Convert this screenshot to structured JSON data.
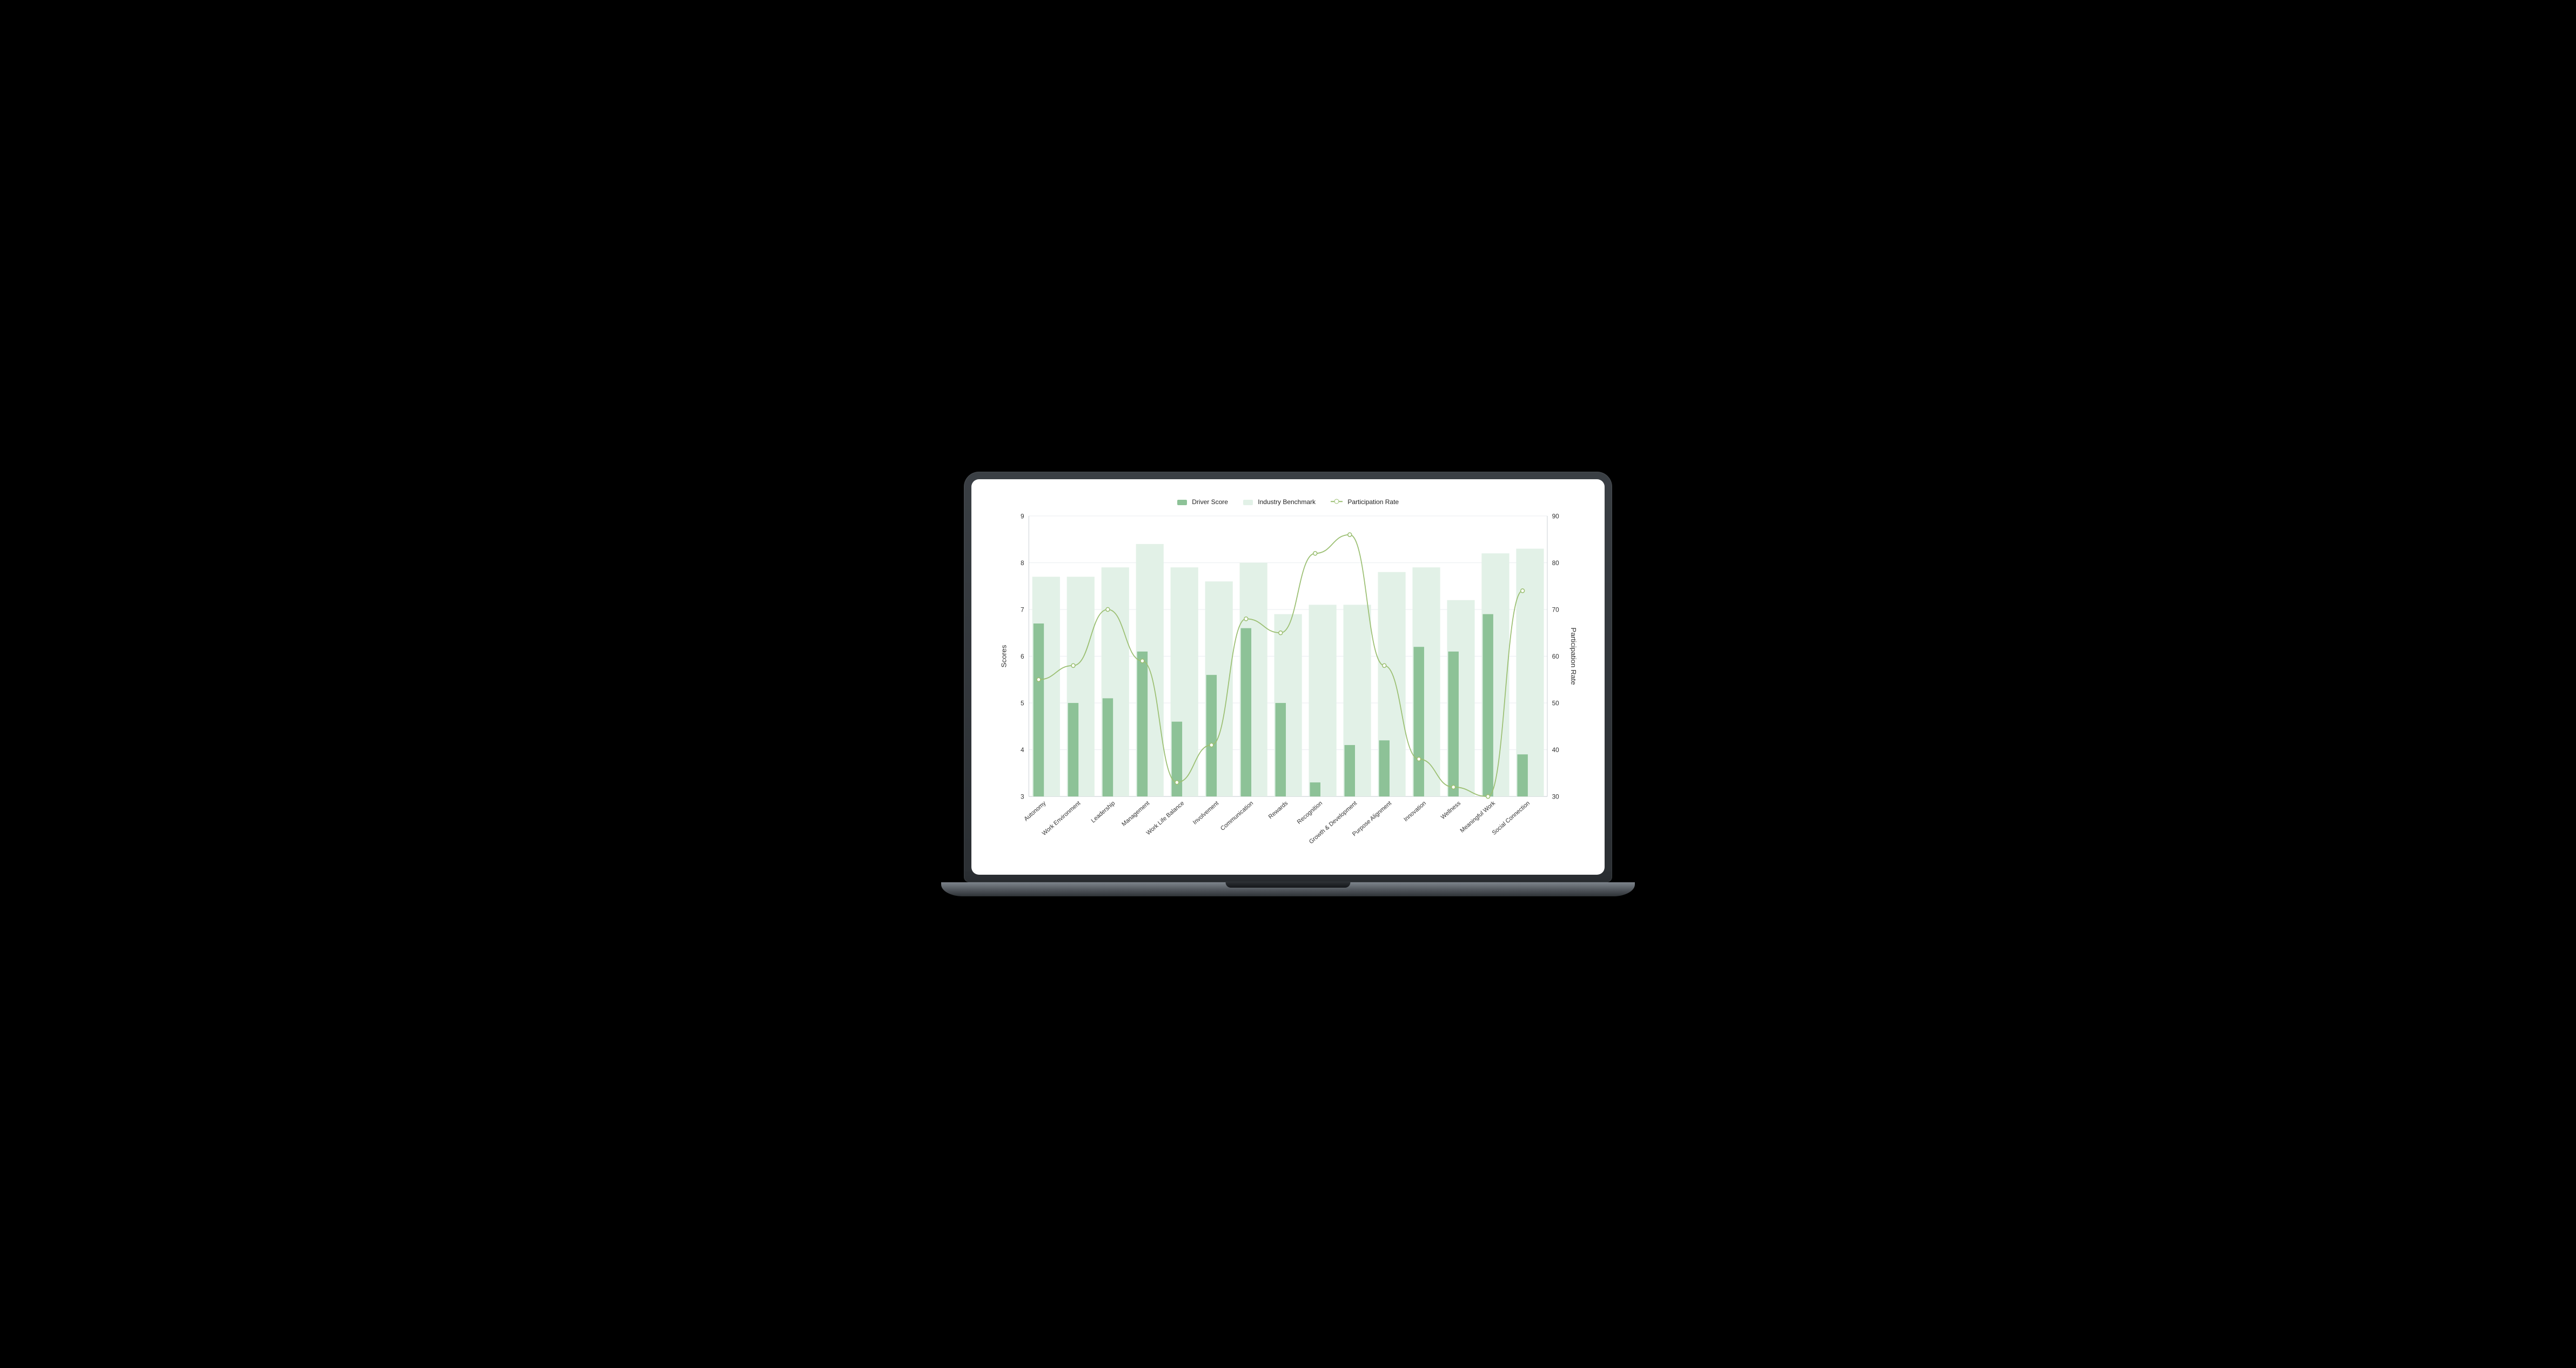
{
  "legend": {
    "driver": "Driver Score",
    "benchmark": "Industry Benchmark",
    "participation": "Participation Rate"
  },
  "axes": {
    "left_title": "Scores",
    "right_title": "Participation Rate"
  },
  "colors": {
    "driver": "#8dc297",
    "benchmark": "#e2f1e7",
    "line": "#9bbf72",
    "grid": "#eceff1"
  },
  "chart_data": {
    "type": "bar",
    "categories": [
      "Autonomy",
      "Work Environment",
      "Leadership",
      "Management",
      "Work Life Balance",
      "Involvement",
      "Communication",
      "Rewards",
      "Recognition",
      "Growth & Development",
      "Purpose Alignment",
      "Innovation",
      "Wellness",
      "Meaningful Work",
      "Social Connection"
    ],
    "series": [
      {
        "name": "Driver Score",
        "values": [
          6.7,
          5.0,
          5.1,
          6.1,
          4.6,
          5.6,
          6.6,
          5.0,
          3.3,
          4.1,
          4.2,
          6.2,
          6.1,
          6.9,
          3.9
        ]
      },
      {
        "name": "Industry Benchmark",
        "values": [
          7.7,
          7.7,
          7.9,
          8.4,
          7.9,
          7.6,
          8.0,
          6.9,
          7.1,
          7.1,
          7.8,
          7.9,
          7.2,
          8.2,
          8.3
        ]
      },
      {
        "name": "Participation Rate",
        "values": [
          55,
          58,
          70,
          59,
          33,
          41,
          68,
          65,
          82,
          86,
          58,
          38,
          32,
          30,
          74
        ]
      }
    ],
    "y_left": {
      "label": "Scores",
      "min": 3,
      "max": 9,
      "ticks": [
        3,
        4,
        5,
        6,
        7,
        8,
        9
      ]
    },
    "y_right": {
      "label": "Participation Rate",
      "min": 30,
      "max": 90,
      "ticks": [
        30,
        40,
        50,
        60,
        70,
        80,
        90
      ]
    },
    "xlabel": "",
    "title": ""
  }
}
